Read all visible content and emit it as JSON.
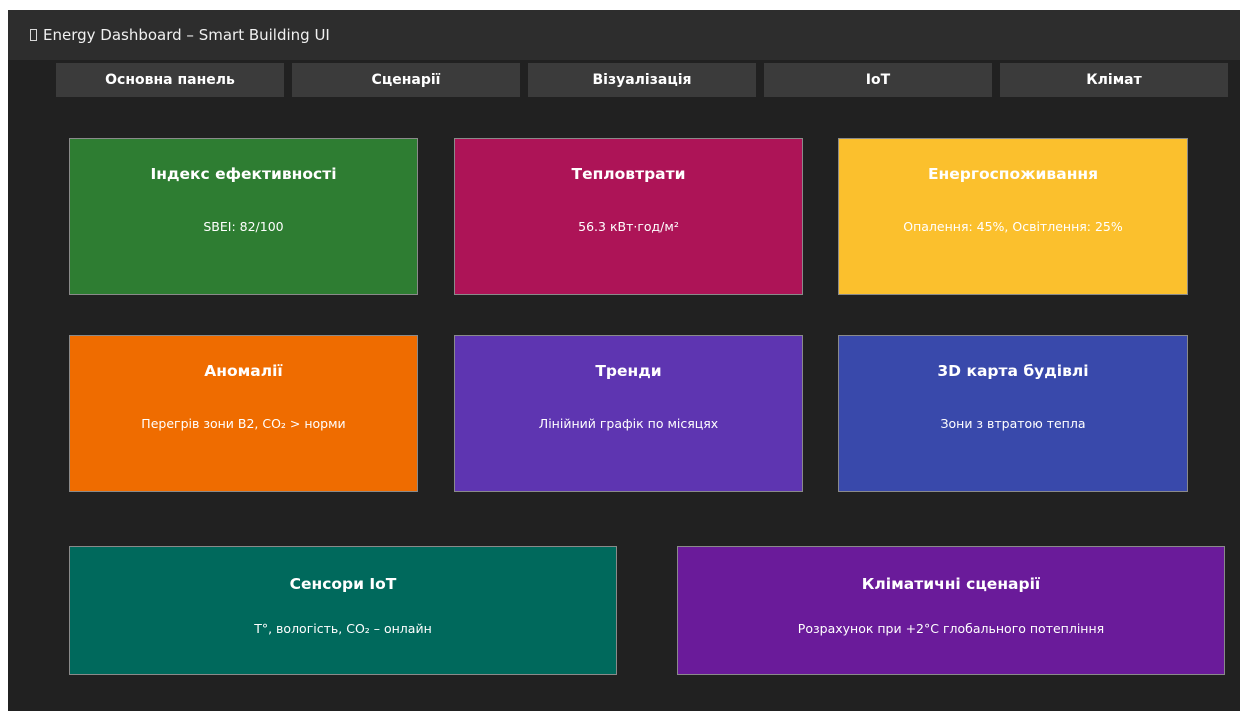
{
  "window": {
    "title": "Energy Dashboard – Smart Building UI",
    "icon": "app-icon-placeholder"
  },
  "tabs": [
    {
      "label": "Основна панель"
    },
    {
      "label": "Сценарії"
    },
    {
      "label": "Візуалізація"
    },
    {
      "label": "IoT"
    },
    {
      "label": "Клімат"
    }
  ],
  "cards": [
    {
      "title": "Індекс ефективності",
      "value": "SBEI: 82/100",
      "color": "#2e7d32"
    },
    {
      "title": "Тепловтрати",
      "value": "56.3 кВт·год/м²",
      "color": "#ad1457"
    },
    {
      "title": "Енергоспоживання",
      "value": "Опалення: 45%, Освітлення: 25%",
      "color": "#fbc02d"
    },
    {
      "title": "Аномалії",
      "value": "Перегрів зони B2, CO₂ > норми",
      "color": "#ef6c00"
    },
    {
      "title": "Тренди",
      "value": "Лінійний графік по місяцях",
      "color": "#5e35b1"
    },
    {
      "title": "3D карта будівлі",
      "value": "Зони з втратою тепла",
      "color": "#3949ab"
    },
    {
      "title": "Сенсори IoT",
      "value": "T°, вологість, CO₂ – онлайн",
      "color": "#00695c"
    },
    {
      "title": "Кліматичні сценарії",
      "value": "Розрахунок при +2°C глобального потепління",
      "color": "#6a1b9a"
    }
  ],
  "colors": {
    "background": "#212121",
    "titlebar": "#2d2d2d",
    "tab": "#3b3b3b",
    "card_border": "#8a8a8a"
  }
}
